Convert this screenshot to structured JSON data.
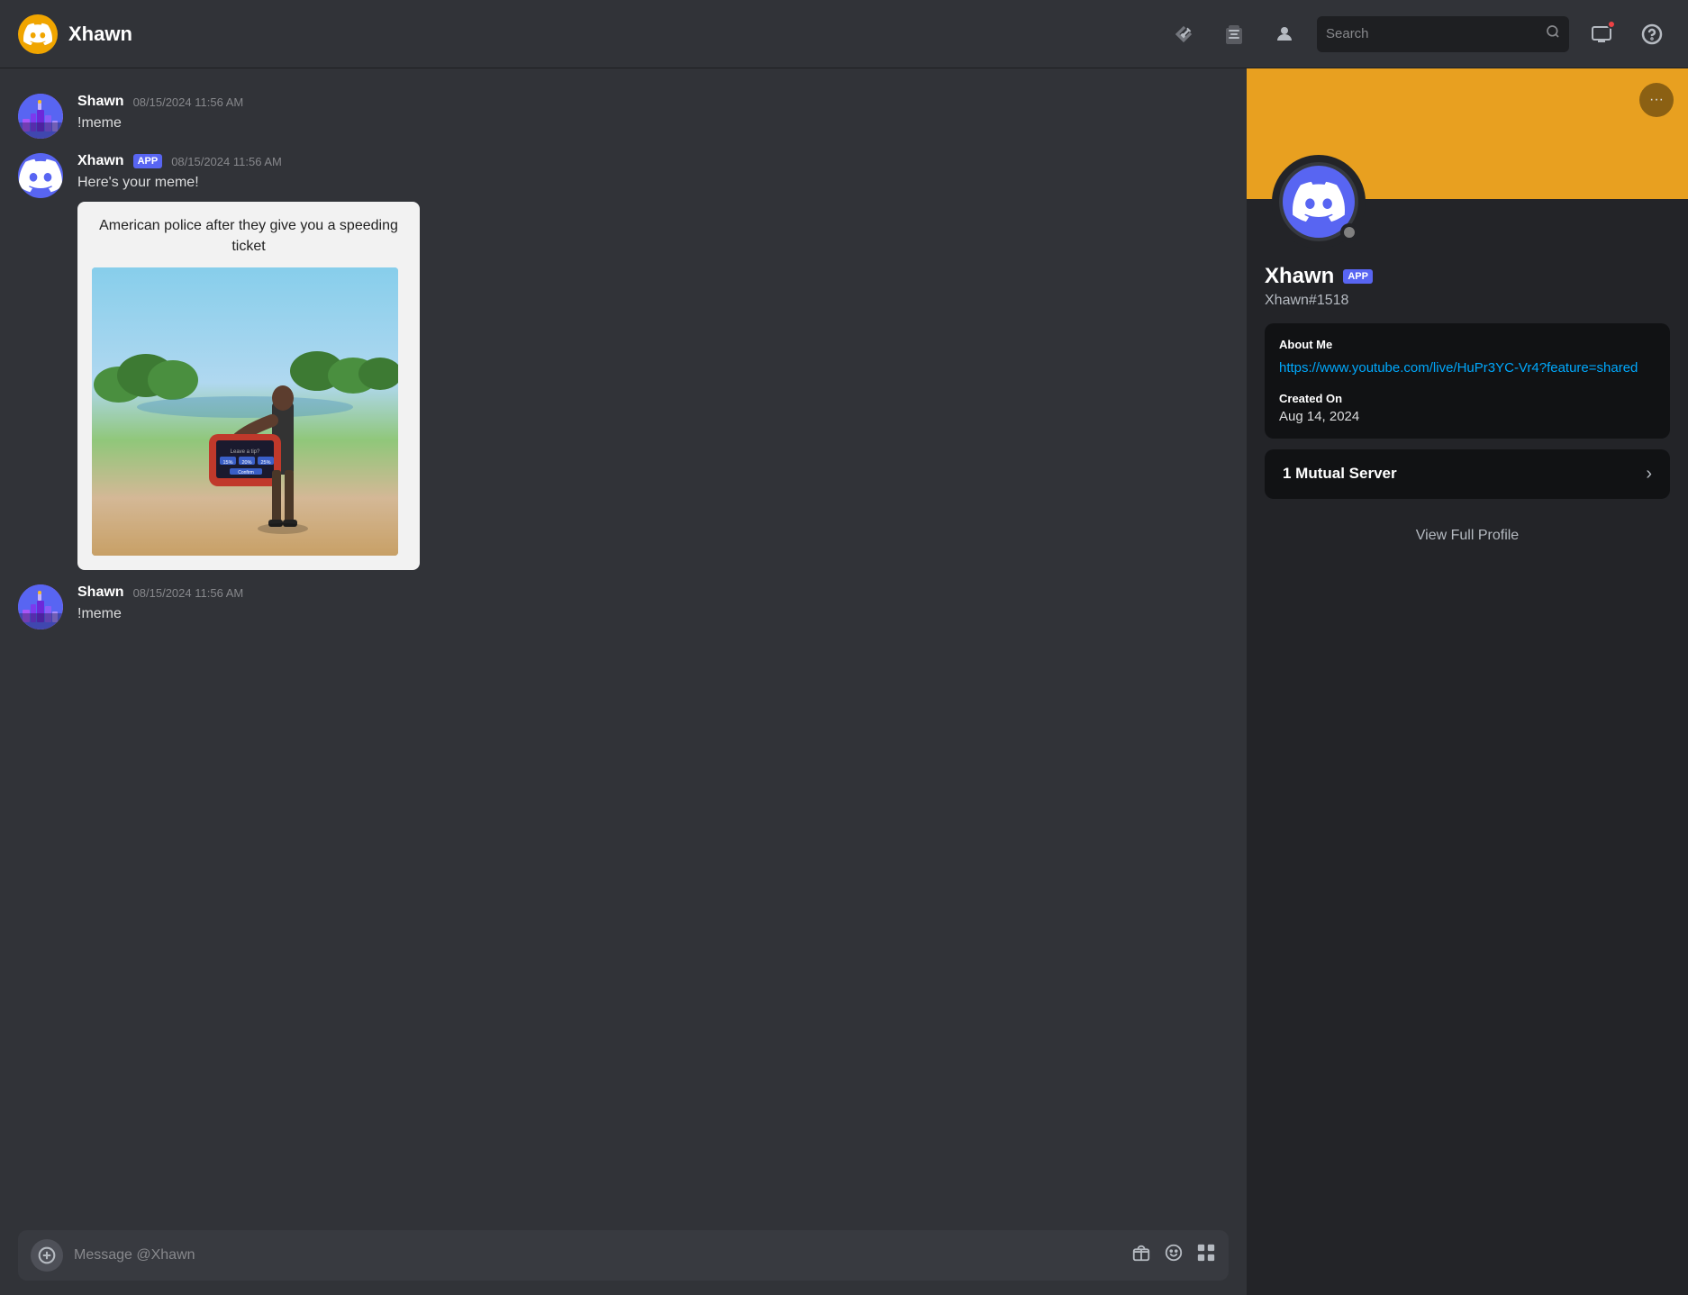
{
  "topbar": {
    "channel_name": "Xhawn",
    "search_placeholder": "Search",
    "icons": {
      "pin": "📌",
      "add_member": "👥",
      "profile": "👤",
      "help": "?"
    }
  },
  "chat": {
    "messages": [
      {
        "id": "msg1",
        "author": "Shawn",
        "author_type": "user",
        "timestamp": "08/15/2024 11:56 AM",
        "text": "!meme"
      },
      {
        "id": "msg2",
        "author": "Xhawn",
        "author_type": "bot",
        "badge": "APP",
        "timestamp": "08/15/2024 11:56 AM",
        "text": "Here's your meme!",
        "meme": {
          "caption": "American police after they give you a speeding ticket",
          "has_image": true
        }
      },
      {
        "id": "msg3",
        "author": "Shawn",
        "author_type": "user",
        "timestamp": "08/15/2024 11:56 AM",
        "text": "!meme"
      }
    ],
    "input_placeholder": "Message @Xhawn"
  },
  "profile": {
    "name": "Xhawn",
    "badge": "APP",
    "tag": "Xhawn#1518",
    "about_me_title": "About Me",
    "about_me_link": "https://www.youtube.com/live/HuPr3YC-Vr4?feature=shared",
    "created_on_title": "Created On",
    "created_on_date": "Aug 14, 2024",
    "mutual_servers_text": "1 Mutual Server",
    "view_full_profile": "View Full Profile",
    "more_btn_label": "···"
  }
}
